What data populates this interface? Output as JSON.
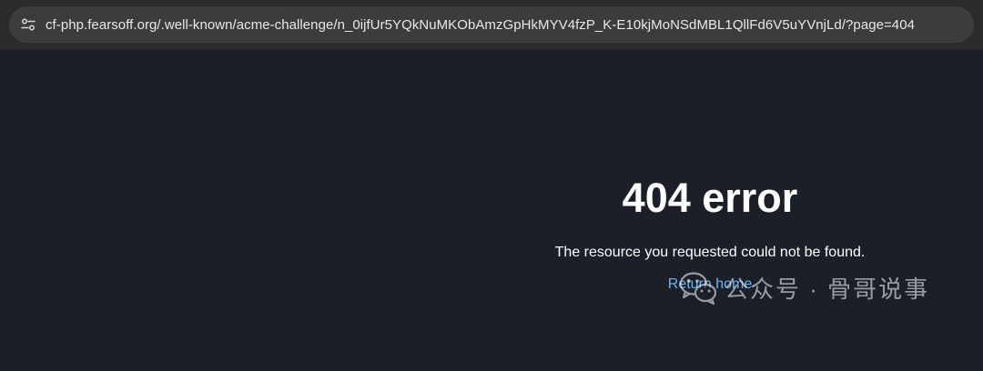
{
  "browser": {
    "url": "cf-php.fearsoff.org/.well-known/acme-challenge/n_0ijfUr5YQkNuMKObAmzGpHkMYV4fzP_K-E10kjMoNSdMBL1QllFd6V5uYVnjLd/?page=404",
    "site_info_icon": "tune-icon"
  },
  "page": {
    "title": "404 error",
    "message": "The resource you requested could not be found.",
    "return_link": "Return home"
  },
  "watermark": {
    "text": "公众号 · 骨哥说事",
    "logo_icon": "wechat-icon"
  },
  "colors": {
    "page_background": "#1b1f28",
    "link": "#6cb2f0",
    "address_bar": "#3c3c3f"
  }
}
